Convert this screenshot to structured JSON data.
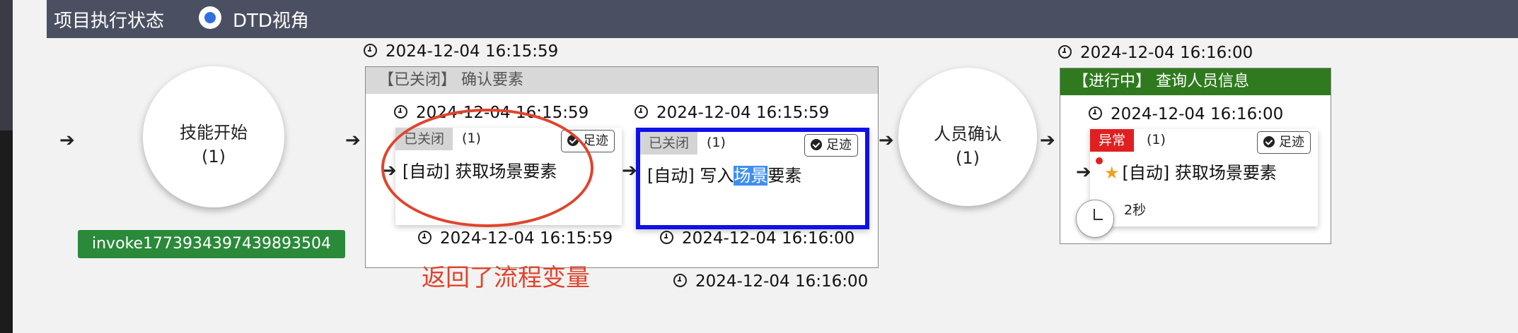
{
  "header": {
    "title": "项目执行状态",
    "view_label": "DTD视角"
  },
  "nodes": {
    "start": {
      "name": "技能开始",
      "count": "(1)",
      "invoke_id": "invoke1773934397439893504"
    },
    "confirm_person": {
      "name": "人员确认",
      "count": "(1)"
    }
  },
  "group1": {
    "time": "2024-12-04 16:15:59",
    "header": "【已关闭】 确认要素",
    "end_time": "2024-12-04 16:16:00",
    "card1": {
      "start_time": "2024-12-04 16:15:59",
      "status": "已关闭",
      "count": "(1)",
      "trace_label": "足迹",
      "text": "[自动] 获取场景要素",
      "end_time": "2024-12-04 16:15:59"
    },
    "card2": {
      "start_time": "2024-12-04 16:15:59",
      "status": "已关闭",
      "count": "(1)",
      "trace_label": "足迹",
      "text_pre": "[自动] 写入",
      "text_hl": "场景",
      "text_post": "要素",
      "end_time": "2024-12-04 16:16:00"
    }
  },
  "group2": {
    "time": "2024-12-04 16:16:00",
    "header": "【进行中】 查询人员信息",
    "card": {
      "start_time": "2024-12-04 16:16:00",
      "status": "异常",
      "count": "(1)",
      "trace_label": "足迹",
      "text": "[自动] 获取场景要素",
      "duration": "2秒"
    }
  },
  "annotation": {
    "text": "返回了流程变量"
  },
  "colors": {
    "header_bg": "#4a5061",
    "green": "#2a8a3a",
    "closed_badge": "#d4d4d4",
    "error_badge": "#e02020",
    "highlight_border": "#1010e8",
    "annotation": "#e0442c"
  }
}
